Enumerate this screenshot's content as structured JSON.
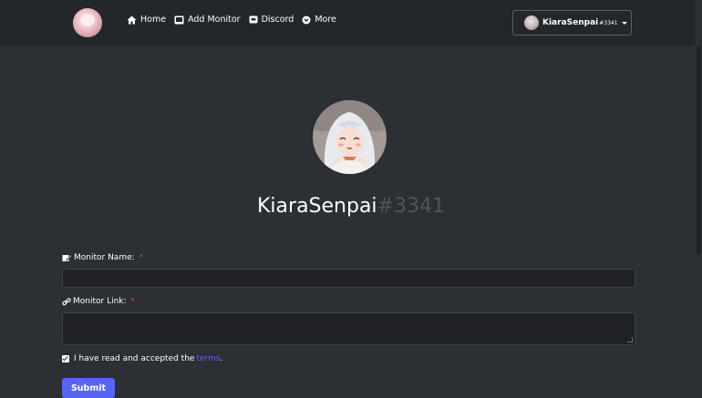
{
  "nav": {
    "items": [
      {
        "label": "Home",
        "icon": "home-icon"
      },
      {
        "label": "Add Monitor",
        "icon": "monitor-icon"
      },
      {
        "label": "Discord",
        "icon": "discord-icon"
      },
      {
        "label": "More",
        "icon": "chevron-circle-down-icon"
      }
    ],
    "user": {
      "name": "KiaraSenpai",
      "tag": "#3341"
    }
  },
  "profile": {
    "name": "KiaraSenpai",
    "tag": "#3341"
  },
  "form": {
    "monitor_name_label": "Monitor Name:",
    "monitor_name_value": "",
    "monitor_link_label": "Monitor Link:",
    "monitor_link_value": "",
    "required_mark": "*",
    "terms_text": "I have read and accepted the",
    "terms_link": "terms",
    "terms_end": ".",
    "terms_checked": true,
    "submit_label": "Submit"
  },
  "colors": {
    "background": "#2c2f33",
    "navbar": "#23272a",
    "accent": "#5865f2",
    "required": "#e4423b",
    "tag": "#4f545c"
  }
}
